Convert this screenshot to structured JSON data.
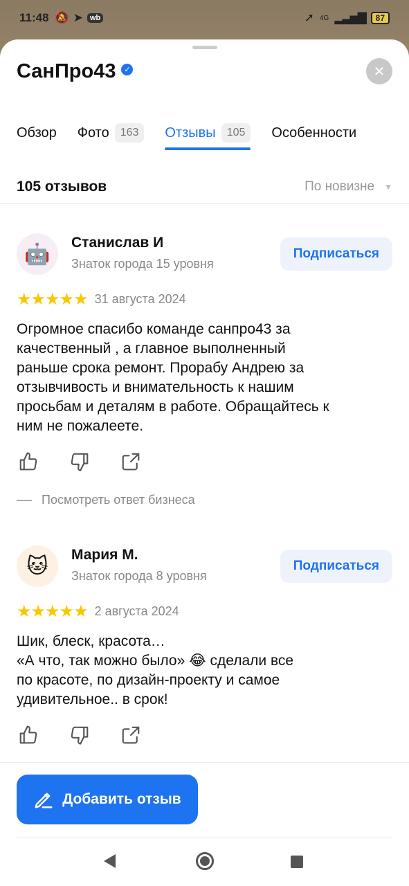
{
  "status": {
    "time": "11:48",
    "wb": "wb",
    "network": "4G",
    "battery": "87"
  },
  "header": {
    "title": "СанПро43",
    "close_icon": "close-icon"
  },
  "tabs": [
    {
      "label": "Обзор",
      "count": ""
    },
    {
      "label": "Фото",
      "count": "163"
    },
    {
      "label": "Отзывы",
      "count": "105",
      "active": true
    },
    {
      "label": "Особенности",
      "count": ""
    }
  ],
  "summary": {
    "count_label": "105 отзывов",
    "sort_label": "По новизне"
  },
  "reviews": [
    {
      "author": "Станислав И",
      "level": "Знаток города 15 уровня",
      "subscribe": "Подписаться",
      "stars": "★★★★★",
      "date": "31 августа 2024",
      "text": "Огромное спасибо команде санпро43 за\nкачественный , а главное выполненный\nраньше срока ремонт. Прорабу Андрею за\nотзывчивость и внимательность к нашим\nпросьбам и деталям в работе. Обращайтесь к\nним не пожалеете.",
      "business_reply": "Посмотреть ответ бизнеса",
      "avatar": "🤖"
    },
    {
      "author": "Мария М.",
      "level": "Знаток города 8 уровня",
      "subscribe": "Подписаться",
      "stars": "★★★★★",
      "date": "2 августа 2024",
      "text": "Шик, блеск, красота…\n«А что, так можно было» 😂 сделали все\nпо красоте, по дизайн-проекту и самое\nудивительное.. в срок!",
      "avatar": "🐱"
    }
  ],
  "footer": {
    "add_review": "Добавить отзыв"
  },
  "colors": {
    "accent": "#1e73f0",
    "star": "#f9c700"
  }
}
